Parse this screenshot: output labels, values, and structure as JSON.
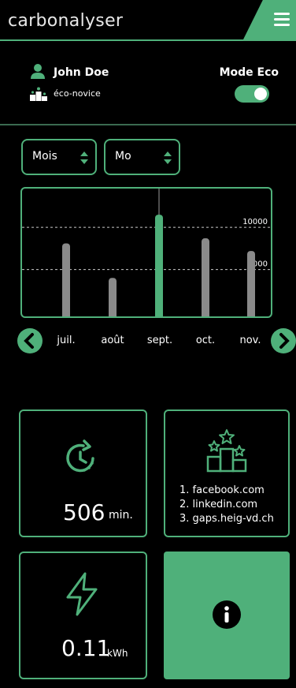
{
  "app": {
    "brand": "carbonalyser"
  },
  "profile": {
    "user_name": "John Doe",
    "rank": "éco-novice",
    "eco_mode_label": "Mode Eco",
    "eco_mode_on": true
  },
  "filters": {
    "period": {
      "value": "Mois"
    },
    "unit": {
      "value": "Mo"
    }
  },
  "chart_data": {
    "type": "bar",
    "categories": [
      "juil.",
      "août",
      "sept.",
      "oct.",
      "nov."
    ],
    "values": [
      8100,
      4000,
      11500,
      8700,
      7200
    ],
    "highlight_index": 2,
    "reference_lines": [
      10000,
      5000
    ],
    "ylim": [
      0,
      14600
    ],
    "colors": {
      "bar": "#8a8a8a",
      "highlight": "#4fb07a",
      "grid": "#ffffff"
    }
  },
  "stats": {
    "time": {
      "value": "506",
      "unit": "min."
    },
    "top_sites": {
      "items": [
        "1. facebook.com",
        "2. linkedin.com",
        "3. gaps.heig-vd.ch"
      ]
    },
    "energy": {
      "value": "0.11",
      "unit": "kWh"
    }
  },
  "colors": {
    "accent": "#4fb07a",
    "background": "#000000"
  }
}
